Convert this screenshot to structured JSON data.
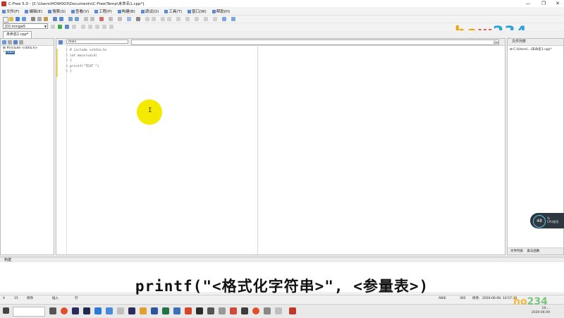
{
  "window": {
    "title": "C-Free 5.0 - [C:\\Users\\HOW003\\Documents\\C-Free\\Temp\\未命名1.cpp*]",
    "controls": [
      "—",
      "❐",
      "✕"
    ]
  },
  "menu": [
    "文件(F)",
    "编辑(E)",
    "搜索(S)",
    "查看(V)",
    "工程(P)",
    "构建(B)",
    "调试(D)",
    "工具(T)",
    "窗口(W)",
    "帮助(H)"
  ],
  "toolbar": {
    "compiler": "[D] mingw5"
  },
  "file_tab": "未命名1.cpp*",
  "class_tree": {
    "include": "#include <stdio.h>",
    "main": "main"
  },
  "editor": {
    "function_selector": "main",
    "code_lines": [
      {
        "n": "1",
        "text": "# include <stdio.h>"
      },
      {
        "n": "2",
        "text": "int main(void)"
      },
      {
        "n": "3",
        "text": "{"
      },
      {
        "n": "4",
        "text": "printf(\"TEXT \")"
      },
      {
        "n": "5",
        "text": "}"
      }
    ]
  },
  "right_panel": {
    "header": "文件列表",
    "top_right": "Go",
    "file_entry": "C:\\Users\\...\\未命名1.cpp*",
    "tab_file_list": "文件列表",
    "tab_class_list": "类与函数"
  },
  "cpu_widget": {
    "percent": "48",
    "unit": "%",
    "label": "CPU使用"
  },
  "output_header": "构建",
  "subtitle": "printf(\"<格式化字符串>\", <参量表>)",
  "status": {
    "row": "4",
    "col": "15",
    "mode": "插入",
    "modify": "修改",
    "lines": "行",
    "encoding": "ANSI",
    "size": "392",
    "modified_label": "修改:",
    "datetime": "2020-06-09, 10:57:33"
  },
  "taskbar": {
    "time": "16:...",
    "date": "2020-06-09"
  },
  "logo": {
    "part1": "ho",
    "part2": "w",
    "part3": "234"
  },
  "colors": {
    "selection": "#3a6ea5",
    "highlight_yellow": "#f3ea00",
    "cpu_ring": "#5ac8f5"
  }
}
